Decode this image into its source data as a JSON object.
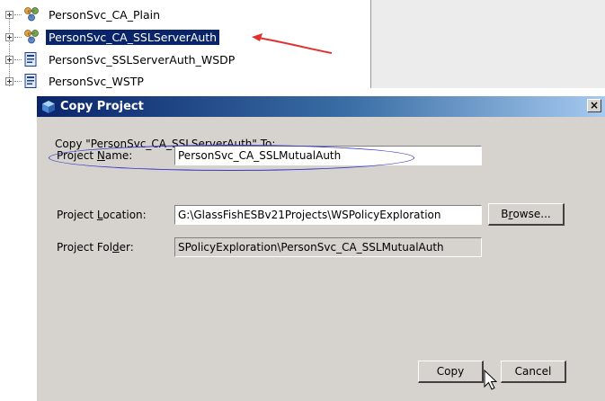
{
  "tree": {
    "items": [
      {
        "label": "PersonSvc_CA_Plain",
        "icon": "composite-app-icon",
        "selected": false
      },
      {
        "label": "PersonSvc_CA_SSLServerAuth",
        "icon": "composite-app-icon",
        "selected": true
      },
      {
        "label": "PersonSvc_SSLServerAuth_WSDP",
        "icon": "bpel-module-icon",
        "selected": false
      },
      {
        "label": "PersonSvc_WSTP",
        "icon": "bpel-module-icon",
        "selected": false
      }
    ]
  },
  "dialog": {
    "title": "Copy Project",
    "close_glyph": "×",
    "description": "Copy \"PersonSvc_CA_SSLServerAuth\" To:",
    "fields": {
      "name": {
        "label_pre": "Project ",
        "label_mnemonic": "N",
        "label_post": "ame:",
        "value": "PersonSvc_CA_SSLMutualAuth"
      },
      "location": {
        "label_pre": "Project ",
        "label_mnemonic": "L",
        "label_post": "ocation:",
        "value": "G:\\GlassFishESBv21Projects\\WSPolicyExploration"
      },
      "folder": {
        "label_pre": "Project Fol",
        "label_mnemonic": "d",
        "label_post": "er:",
        "value": "SPolicyExploration\\PersonSvc_CA_SSLMutualAuth"
      }
    },
    "browse": {
      "pre": "B",
      "mnemonic": "r",
      "post": "owse..."
    },
    "copy_label": "Copy",
    "cancel_label": "Cancel"
  },
  "colors": {
    "selection": "#0a246a",
    "annotation_arrow": "#e03030",
    "annotation_ellipse": "#3535c8",
    "dialog_bg": "#d6d3ce"
  }
}
